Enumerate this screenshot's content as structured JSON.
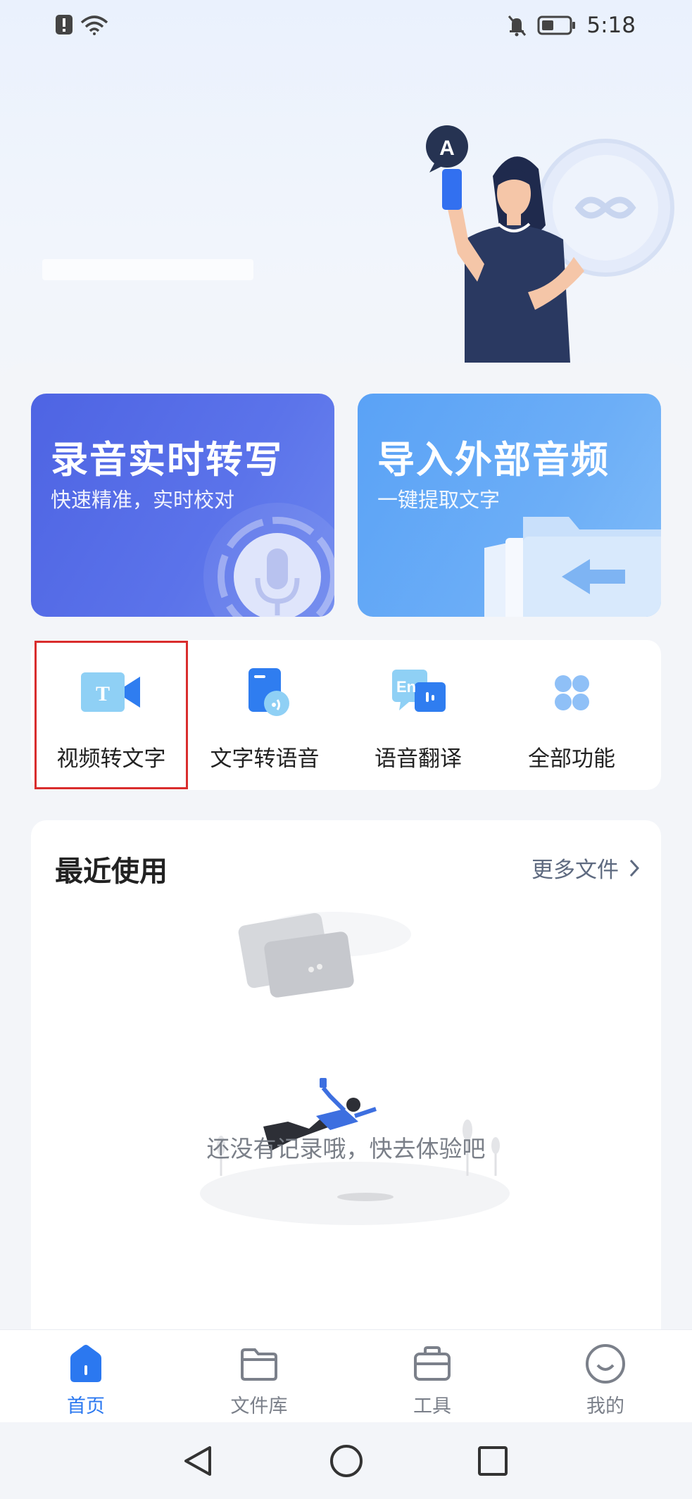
{
  "status_bar": {
    "time": "5:18"
  },
  "cards": {
    "record": {
      "title": "录音实时转写",
      "subtitle": "快速精准，实时校对"
    },
    "import": {
      "title": "导入外部音频",
      "subtitle": "一键提取文字"
    }
  },
  "tools": [
    {
      "label": "视频转文字",
      "icon": "video-text-icon"
    },
    {
      "label": "文字转语音",
      "icon": "doc-audio-icon"
    },
    {
      "label": "语音翻译",
      "icon": "translate-icon"
    },
    {
      "label": "全部功能",
      "icon": "grid-icon"
    }
  ],
  "recent": {
    "title": "最近使用",
    "more_label": "更多文件",
    "empty_text": "还没有记录哦，快去体验吧"
  },
  "tabbar": [
    {
      "label": "首页",
      "active": true
    },
    {
      "label": "文件库",
      "active": false
    },
    {
      "label": "工具",
      "active": false
    },
    {
      "label": "我的",
      "active": false
    }
  ],
  "colors": {
    "accent": "#2b78f0",
    "record_card": "#5168e5",
    "import_card": "#64a8f6",
    "selection_outline": "#d92d2d"
  }
}
